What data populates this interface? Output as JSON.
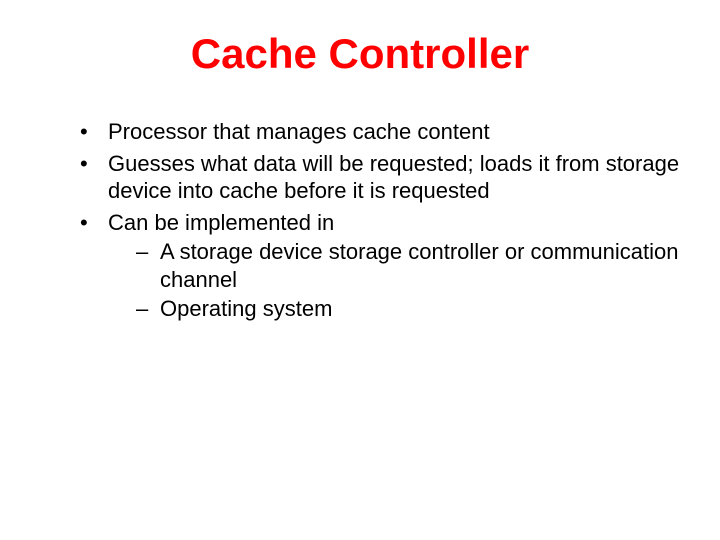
{
  "title": "Cache Controller",
  "bullets": [
    {
      "text": "Processor that manages cache content"
    },
    {
      "text": "Guesses what data will be requested; loads it from storage device into cache before it is requested"
    },
    {
      "text": "Can be implemented in",
      "sub": [
        "A storage device storage controller or communication channel",
        "Operating system"
      ]
    }
  ]
}
